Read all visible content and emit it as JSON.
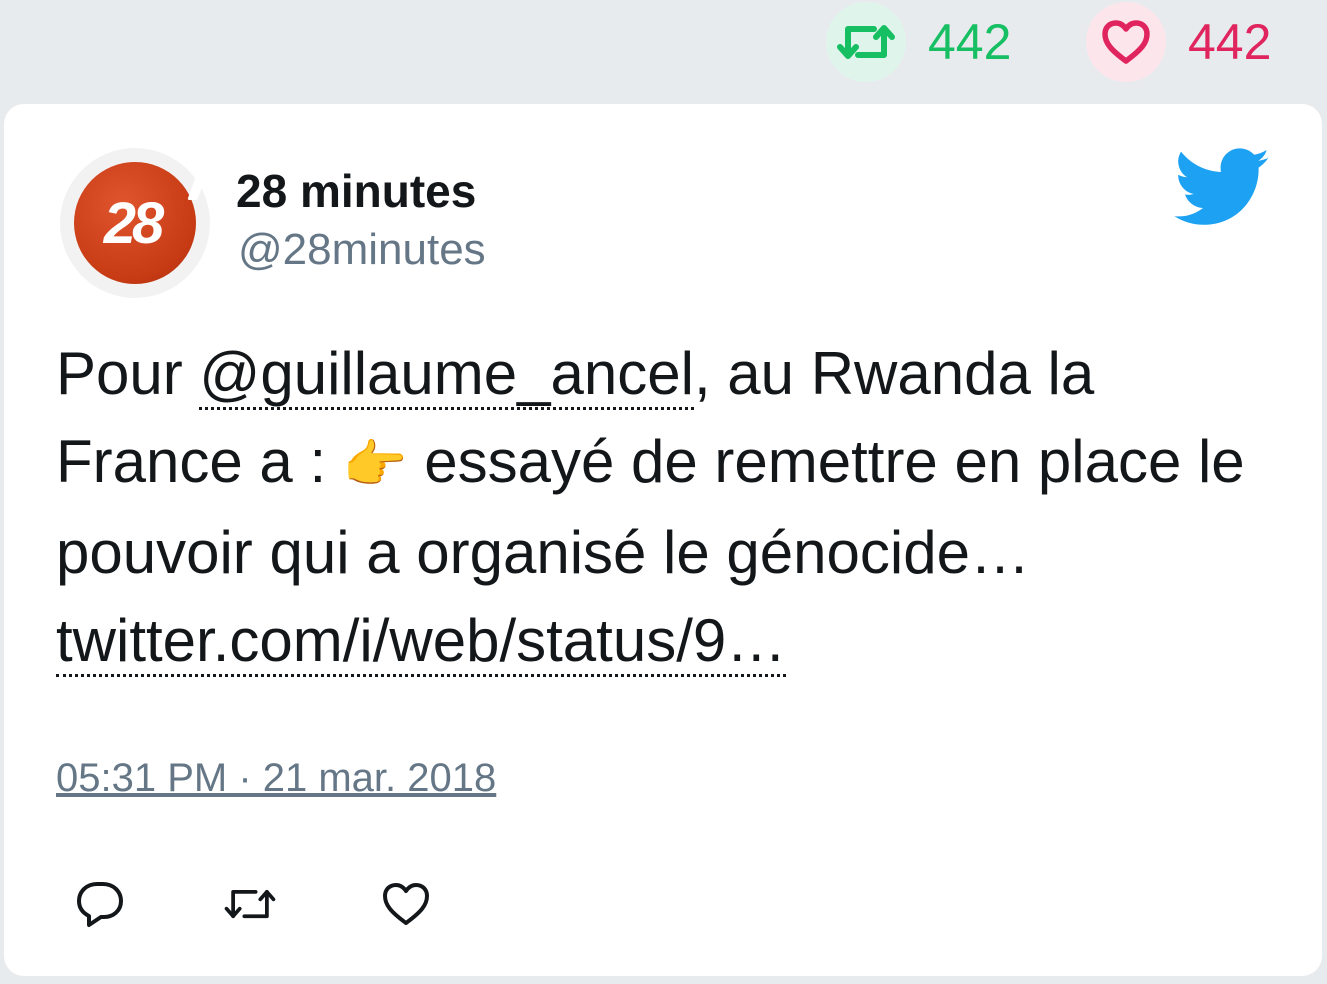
{
  "stats": {
    "retweet_count": "442",
    "like_count": "442"
  },
  "tweet": {
    "author_name": "28 minutes",
    "author_handle": "@28minutes",
    "avatar_text": "28",
    "text_part1": "Pour ",
    "mention": "@guillaume_ancel",
    "text_part2": ", au Rwanda la France a : ",
    "emoji": "👉",
    "text_part3": " essayé de remettre en place le pouvoir qui a organisé le génocide… ",
    "link": "twitter.com/i/web/status/9…",
    "timestamp": "05:31 PM · 21 mar. 2018"
  },
  "colors": {
    "retweet_green": "#17bf63",
    "like_red": "#e0245e",
    "twitter_blue": "#1da1f2",
    "secondary_gray": "#657786"
  },
  "icons": {
    "retweet": "retweet-icon",
    "like": "heart-icon",
    "reply": "reply-icon",
    "logo": "twitter-bird-icon"
  }
}
